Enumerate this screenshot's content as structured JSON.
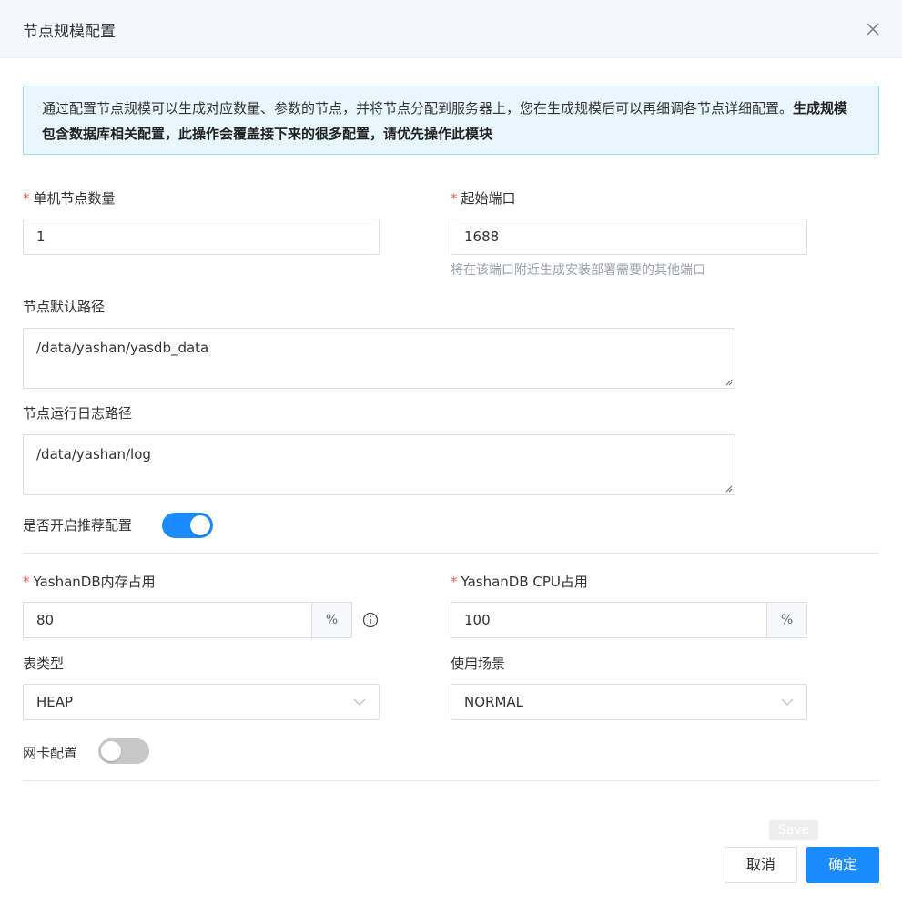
{
  "dialog": {
    "title": "节点规模配置",
    "close_icon": "close-icon"
  },
  "notice": {
    "text_normal": "通过配置节点规模可以生成对应数量、参数的节点，并将节点分配到服务器上，您在生成规模后可以再细调各节点详细配置。",
    "text_bold": "生成规模包含数据库相关配置，此操作会覆盖接下来的很多配置，请优先操作此模块"
  },
  "form": {
    "required_mark": "*",
    "node_count": {
      "label": "单机节点数量",
      "value": "1"
    },
    "start_port": {
      "label": "起始端口",
      "value": "1688",
      "helper": "将在该端口附近生成安装部署需要的其他端口"
    },
    "default_path": {
      "label": "节点默认路径",
      "value": "/data/yashan/yasdb_data"
    },
    "log_path": {
      "label": "节点运行日志路径",
      "value": "/data/yashan/log"
    },
    "recommend": {
      "label": "是否开启推荐配置",
      "on": true
    },
    "memory": {
      "label": "YashanDB内存占用",
      "value": "80",
      "unit": "%"
    },
    "cpu": {
      "label": "YashanDB CPU占用",
      "value": "100",
      "unit": "%"
    },
    "table_type": {
      "label": "表类型",
      "value": "HEAP"
    },
    "scenario": {
      "label": "使用场景",
      "value": "NORMAL"
    },
    "nic": {
      "label": "网卡配置",
      "on": false
    }
  },
  "footer": {
    "save_chip": "Save",
    "cancel": "取消",
    "confirm": "确定"
  },
  "colors": {
    "primary": "#1a8cff",
    "switch_off": "#c8c8c8",
    "required": "#f25a5a"
  }
}
